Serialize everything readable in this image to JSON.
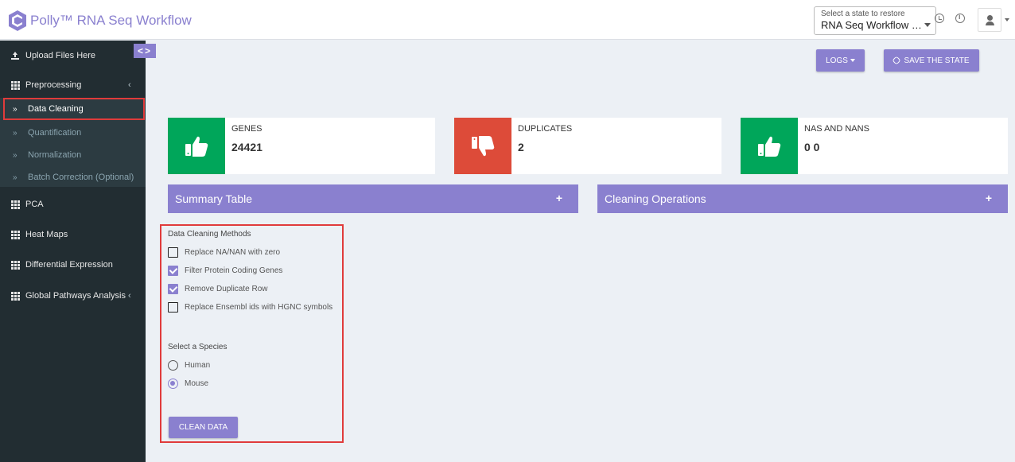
{
  "header": {
    "app_title": "Polly™ RNA Seq Workflow",
    "state_label": "Select a state to restore",
    "state_value": "RNA Seq Workflow U..."
  },
  "sidebar": {
    "items": [
      {
        "label": "Upload Files Here"
      },
      {
        "label": "Preprocessing",
        "arrow": "‹"
      },
      {
        "label": "PCA"
      },
      {
        "label": "Heat Maps"
      },
      {
        "label": "Differential Expression"
      },
      {
        "label": "Global Pathways Analysis",
        "arrow": "‹"
      }
    ],
    "subitems": [
      {
        "label": "Data Cleaning"
      },
      {
        "label": "Quantification"
      },
      {
        "label": "Normalization"
      },
      {
        "label": "Batch Correction (Optional)"
      }
    ],
    "toggle_label": "<>"
  },
  "toolbar": {
    "logs_label": "LOGS",
    "save_label": "SAVE THE STATE"
  },
  "info_boxes": [
    {
      "title": "GENES",
      "value": "24421",
      "status": "green",
      "color": "#00a65a"
    },
    {
      "title": "DUPLICATES",
      "value": "2",
      "status": "red",
      "color": "#dd4b39"
    },
    {
      "title": "NAS AND NANS",
      "value": "0 0",
      "status": "green",
      "color": "#00a65a"
    }
  ],
  "panels": {
    "summary_title": "Summary Table",
    "cleaning_title": "Cleaning Operations",
    "expand_symbol": "+"
  },
  "cleaning": {
    "methods_label": "Data Cleaning Methods",
    "methods": [
      {
        "label": "Replace NA/NAN with zero",
        "checked": false
      },
      {
        "label": "Filter Protein Coding Genes",
        "checked": true
      },
      {
        "label": "Remove Duplicate Row",
        "checked": true
      },
      {
        "label": "Replace Ensembl ids with HGNC symbols",
        "checked": false
      }
    ],
    "species_label": "Select a Species",
    "species": [
      {
        "label": "Human",
        "selected": false
      },
      {
        "label": "Mouse",
        "selected": true
      }
    ],
    "clean_button": "CLEAN DATA"
  },
  "colors": {
    "accent": "#8a80cf",
    "sidebar_bg": "#222d32",
    "success": "#00a65a",
    "danger": "#dd4b39",
    "highlight": "#e03b3b"
  }
}
